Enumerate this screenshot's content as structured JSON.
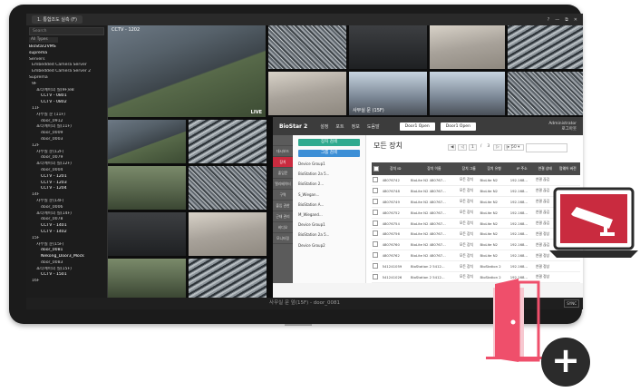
{
  "window": {
    "tab_title": "1. 통합조도 실측 (F)",
    "controls": [
      "?",
      "—",
      "⧉",
      "✕"
    ]
  },
  "sidebar": {
    "search_placeholder": "Search",
    "filter_label": "All Types",
    "items": [
      {
        "label": "BioStar2VMS",
        "depth": 0,
        "highlight": true
      },
      {
        "label": "suprema",
        "depth": 0,
        "highlight": true
      },
      {
        "label": "Servers",
        "depth": 0
      },
      {
        "label": "Embedded Camera Server",
        "depth": 1
      },
      {
        "label": "Embedded Camera Server 2",
        "depth": 1
      },
      {
        "label": "Suprema",
        "depth": 0
      },
      {
        "label": "9F",
        "depth": 1
      },
      {
        "label": "포티에이의 실(9F)e8",
        "depth": 2
      },
      {
        "label": "CCTV - 0801",
        "depth": 3,
        "highlight": true
      },
      {
        "label": "CCTV - 0802",
        "depth": 3,
        "highlight": true
      },
      {
        "label": "11F",
        "depth": 1
      },
      {
        "label": "사무실 문 (11F)",
        "depth": 2
      },
      {
        "label": "door_0912",
        "depth": 3
      },
      {
        "label": "포티에이의 실(11F)",
        "depth": 2
      },
      {
        "label": "door_0009",
        "depth": 3
      },
      {
        "label": "door_0003",
        "depth": 3
      },
      {
        "label": "12F",
        "depth": 1
      },
      {
        "label": "사무실 문(12F)",
        "depth": 2
      },
      {
        "label": "door_0079",
        "depth": 3
      },
      {
        "label": "포티에이의 실(12F)",
        "depth": 2
      },
      {
        "label": "door_0004",
        "depth": 3
      },
      {
        "label": "CCTV - 1201",
        "depth": 3,
        "highlight": true
      },
      {
        "label": "CCTV - 1203",
        "depth": 3,
        "highlight": true
      },
      {
        "label": "CCTV - 1204",
        "depth": 3,
        "highlight": true
      },
      {
        "label": "14F",
        "depth": 1
      },
      {
        "label": "사무실 문(14F)",
        "depth": 2
      },
      {
        "label": "door_0006",
        "depth": 3
      },
      {
        "label": "포티에이의 실(14F)",
        "depth": 2
      },
      {
        "label": "door_0078",
        "depth": 3
      },
      {
        "label": "CCTV - 1401",
        "depth": 3,
        "highlight": true
      },
      {
        "label": "CCTV - 1402",
        "depth": 3,
        "highlight": true
      },
      {
        "label": "15F",
        "depth": 1
      },
      {
        "label": "사무실 문(15F)",
        "depth": 2
      },
      {
        "label": "door_0081",
        "depth": 3,
        "highlight": true
      },
      {
        "label": "Nekong_Door3_Mock",
        "depth": 3,
        "highlight": true
      },
      {
        "label": "door_0083",
        "depth": 3
      },
      {
        "label": "포티에이의 실(15F)",
        "depth": 2
      },
      {
        "label": "CCTV - 1501",
        "depth": 3,
        "highlight": true
      },
      {
        "label": "16F",
        "depth": 1
      }
    ]
  },
  "cameras": {
    "main_label": "CCTV - 1202",
    "live_label": "LIVE",
    "tile_label": "사무실 문 (15F)"
  },
  "app": {
    "brand": "BioStar 2",
    "nav": [
      "설정",
      "포트",
      "정보",
      "도움말"
    ],
    "door_buttons": [
      "Door1 Open",
      "Door1 Open"
    ],
    "admin_name": "Administrator",
    "admin_sub": "로그아웃",
    "side_items": [
      "",
      "대시보드",
      "장치",
      "출입문",
      "엘리베이터",
      "구역",
      "출입 권한",
      "근태 관리",
      "비디오",
      "모니터링"
    ],
    "panel_buttons": [
      "장치 검색",
      "그룹 검색"
    ],
    "panel_items": [
      "Device Group1",
      "BioStation 2a 5...",
      "BioStation 2...",
      "S_Wiegan...",
      "BioStation A...",
      "M_Wiegand...",
      "Device Group1",
      "BioStation 2a 5...",
      "Device Group2"
    ],
    "content_title": "모든 장치",
    "pager": {
      "prev": "◀",
      "prev2": "◁",
      "page": "1",
      "sep": "/",
      "total": "3",
      "next": "▷",
      "next2": "▶"
    },
    "view_select": "50 ▾",
    "table_headers": [
      "",
      "장치 ID",
      "장치 이름",
      "장치 그룹",
      "장치 유형",
      "IP 주소",
      "연결 상태",
      "펌웨어 버전"
    ],
    "rows": [
      [
        "",
        "48076742",
        "BioLite N2 480767...",
        "모든 장치",
        "BioLite N2",
        "192.168...",
        "연결 끊김",
        ""
      ],
      [
        "",
        "48076748",
        "BioLite N2 480767...",
        "모든 장치",
        "BioLite N2",
        "192.168...",
        "연결 끊김",
        ""
      ],
      [
        "",
        "48076749",
        "BioLite N2 480767...",
        "모든 장치",
        "BioLite N2",
        "192.168...",
        "연결 끊김",
        ""
      ],
      [
        "",
        "48076752",
        "BioLite N2 480767...",
        "모든 장치",
        "BioLite N2",
        "192.168...",
        "연결 끊김",
        ""
      ],
      [
        "",
        "48076754",
        "BioLite N2 480767...",
        "모든 장치",
        "BioLite N2",
        "192.168...",
        "연결 끊김",
        ""
      ],
      [
        "",
        "48076756",
        "BioLite N2 480767...",
        "모든 장치",
        "BioLite N2",
        "192.168...",
        "연결 정상",
        ""
      ],
      [
        "",
        "48076760",
        "BioLite N2 480767...",
        "모든 장치",
        "BioLite N2",
        "192.168...",
        "연결 끊김",
        ""
      ],
      [
        "",
        "48076762",
        "BioLite N2 480767...",
        "모든 장치",
        "BioLite N2",
        "192.168...",
        "연결 정상",
        ""
      ],
      [
        "",
        "541241059",
        "BioStation 2 5412...",
        "모든 장치",
        "BioStation 2",
        "192.168...",
        "연결 정상",
        ""
      ],
      [
        "",
        "541241026",
        "BioStation 2 5412...",
        "모든 장치",
        "BioStation 2",
        "192.168...",
        "연결 정상",
        ""
      ]
    ]
  },
  "status": {
    "text": "사무실 문 앞(15F) - door_0081",
    "sync": "SYNC"
  },
  "badges": {
    "plus": "+"
  },
  "colors": {
    "accent": "#c92b3f",
    "green": "#2faa8f",
    "door_pink": "#ef4f6b"
  }
}
